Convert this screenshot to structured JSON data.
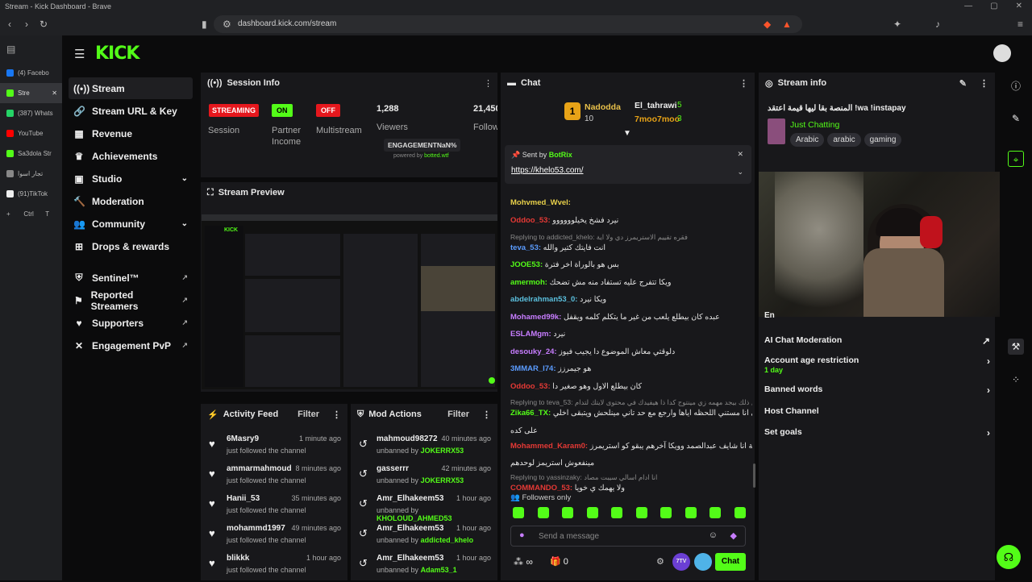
{
  "browser": {
    "window_title": "Stream - Kick Dashboard - Brave",
    "url": "dashboard.kick.com/stream",
    "tabs": [
      {
        "label": "(4) Facebo",
        "color": "#1877f2"
      },
      {
        "label": "Stre",
        "color": "#53fc18"
      },
      {
        "label": "(387) Whats",
        "color": "#25d366"
      },
      {
        "label": "YouTube",
        "color": "#ff0000"
      },
      {
        "label": "Sa3dola Str",
        "color": "#53fc18"
      },
      {
        "label": "تجار اسوا",
        "color": "#888888"
      },
      {
        "label": "(91)TikTok",
        "color": "#eeeeee"
      }
    ],
    "new_tab": "+",
    "ctrl_hint": "Ctrl",
    "t_hint": "T"
  },
  "kick": {
    "logo": "KICK"
  },
  "nav": {
    "items": [
      {
        "label": "Stream",
        "icon": "stream-icon"
      },
      {
        "label": "Stream URL & Key",
        "icon": "link-icon"
      },
      {
        "label": "Revenue",
        "icon": "revenue-icon"
      },
      {
        "label": "Achievements",
        "icon": "trophy-icon"
      },
      {
        "label": "Studio",
        "icon": "studio-icon"
      },
      {
        "label": "Moderation",
        "icon": "hammer-icon"
      },
      {
        "label": "Community",
        "icon": "community-icon"
      },
      {
        "label": "Drops & rewards",
        "icon": "drops-icon"
      },
      {
        "label": "Sentinel™",
        "icon": "shield-icon"
      },
      {
        "label": "Reported Streamers",
        "icon": "flag-icon"
      },
      {
        "label": "Supporters",
        "icon": "heart-icon"
      },
      {
        "label": "Engagement PvP",
        "icon": "pvp-icon"
      }
    ]
  },
  "session": {
    "title": "Session Info",
    "streaming": "STREAMING",
    "session_label": "Session",
    "on": "ON",
    "partner": "Partner",
    "income": "Income",
    "off": "OFF",
    "multistream": "Multistream",
    "viewers": "1,288",
    "viewers_label": "Viewers",
    "followers": "21,450",
    "followers_label": "Follow",
    "engagement": "ENGAGEMENTNaN%",
    "powered": "powered by",
    "botted": "botted.wtf"
  },
  "preview": {
    "title": "Stream Preview"
  },
  "activity": {
    "title": "Activity Feed",
    "filter": "Filter",
    "rows": [
      {
        "name": "6Masry9",
        "sub": "just followed the channel",
        "time": "1 minute ago"
      },
      {
        "name": "ammarmahmoud",
        "sub": "just followed the channel",
        "time": "8 minutes ago"
      },
      {
        "name": "Hanii_53",
        "sub": "just followed the channel",
        "time": "35 minutes ago"
      },
      {
        "name": "mohammd1997",
        "sub": "just followed the channel",
        "time": "49 minutes ago"
      },
      {
        "name": "blikkk",
        "sub": "just followed the channel",
        "time": "1 hour ago"
      }
    ]
  },
  "mod": {
    "title": "Mod Actions",
    "filter": "Filter",
    "rows": [
      {
        "name": "mahmoud98272",
        "action": "unbanned by",
        "by": "JOKERRX53",
        "time": "40 minutes ago"
      },
      {
        "name": "gasserrr",
        "action": "unbanned by",
        "by": "JOKERRX53",
        "time": "42 minutes ago"
      },
      {
        "name": "Amr_Elhakeem53",
        "action": "unbanned by",
        "by": "KHOLOUD_AHMED53",
        "time": "1 hour ago"
      },
      {
        "name": "Amr_Elhakeem53",
        "action": "unbanned by",
        "by": "addicted_khelo",
        "time": "1 hour ago"
      },
      {
        "name": "Amr_Elhakeem53",
        "action": "unbanned by",
        "by": "Adam53_1",
        "time": "1 hour ago"
      }
    ]
  },
  "chat": {
    "title": "Chat",
    "top": [
      {
        "rank": "1",
        "name": "Nadodda",
        "count": "10"
      },
      {
        "name": "El_tahrawi",
        "count": "5"
      },
      {
        "name": "7moo7moo",
        "count": "3"
      }
    ],
    "pinned": {
      "sent_by": "Sent by",
      "bot": "BotRix",
      "link": "https://khelo53.com/"
    },
    "messages": [
      {
        "type": "msg",
        "user": "Mohvmed_Wvel:",
        "color": "#e8d04a",
        "text": ""
      },
      {
        "type": "msg",
        "user": "Oddoo_53:",
        "color": "#e53935",
        "text": "نيرد فشخ يخيلوووووو"
      },
      {
        "type": "reply",
        "text": "Replying to addicted_khelo: فقره تقييم الاستريمرز دي ولا اية"
      },
      {
        "type": "msg",
        "user": "teva_53:",
        "color": "#5b9cff",
        "text": "انت فايتك كتير والله"
      },
      {
        "type": "msg",
        "user": "JOOE53:",
        "color": "#53fc18",
        "text": "بس هو بالوراة اخر فترة"
      },
      {
        "type": "msg",
        "user": "amermoh:",
        "color": "#53fc18",
        "text": "ويكا تتفرج عليه تستفاد منه مش تضحك"
      },
      {
        "type": "msg",
        "user": "abdelrahman53_0:",
        "color": "#5bc0de",
        "text": "ويكا نيرد"
      },
      {
        "type": "msg",
        "user": "Mohamed99k:",
        "color": "#c77dff",
        "text": "عبده كان بيطلع يلعب من غير ما يتكلم كلمه ويقفل"
      },
      {
        "type": "msg",
        "user": "ESLAMgm:",
        "color": "#c77dff",
        "text": "نيرد"
      },
      {
        "type": "msg",
        "user": "desouky_24:",
        "color": "#c77dff",
        "text": "دلوقتي معاش الموضوع دا يجيب فيوز"
      },
      {
        "type": "msg",
        "user": "3MMAR_I74:",
        "color": "#5b9cff",
        "text": "هو جيمرزز"
      },
      {
        "type": "msg",
        "user": "Oddoo_53:",
        "color": "#e53935",
        "text": "كان بيطلع الاول وهو صغير دا"
      },
      {
        "type": "reply",
        "text": "Replying to teva_53: بقالك من ذلك بيجد مهمه زي مينتوج كدا ذا هيفيدك في محتوى لايتك لتدام"
      },
      {
        "type": "msg",
        "user": "Zika66_TX:",
        "color": "#53fc18",
        "text": "بالظبط ويجي انا مستني اللحظه اياها وارجع مع حد تاني مينلحش ويتبقى اخلي"
      },
      {
        "type": "cont",
        "text": "على كده"
      },
      {
        "type": "msg",
        "user": "Mohammed_Karam0:",
        "color": "#e53935",
        "text": "الصراحة انا شايف عبدالصمد وويكا آخرهم يبقو كو استريمرز"
      },
      {
        "type": "cont",
        "text": "مينفعوش استريمز لوحدهم"
      },
      {
        "type": "reply",
        "text": "Replying to yassinzaky: انا ادام اسالي سيبت مصاد"
      },
      {
        "type": "msg",
        "user": "COMMANDO_53:",
        "color": "#e53935",
        "text": "ولا يهمك ي خويا"
      }
    ],
    "followers_only": "Followers only",
    "placeholder": "Send a message",
    "infinity": "∞",
    "zero": "0",
    "ttv": "7TV",
    "btn": "Chat"
  },
  "streaminfo": {
    "title": "Stream info",
    "stream_title": "المنصة بقا ليها قيمة اعتقد !wa !instapay",
    "category": "Just Chatting",
    "tags": [
      "Arabic",
      "arabic",
      "gaming"
    ],
    "ai": "AI Chat Moderation",
    "age": "Account age restriction",
    "age_value": "1 day",
    "banned": "Banned words",
    "host": "Host Channel",
    "goals": "Set goals",
    "partial_en": "En"
  }
}
